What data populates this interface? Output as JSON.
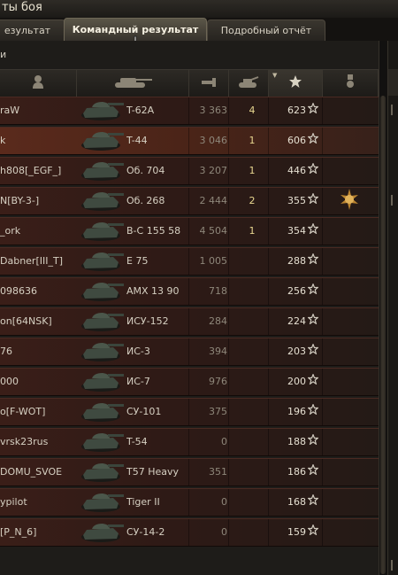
{
  "window": {
    "title": "ты боя"
  },
  "tabs": [
    {
      "label": "езультат",
      "active": false
    },
    {
      "label": "Командный результат",
      "active": true
    },
    {
      "label": "Подробный отчёт",
      "active": false
    }
  ],
  "panel": {
    "corner_label": "и"
  },
  "header": {
    "columns": [
      {
        "name": "player",
        "icon": "person-icon"
      },
      {
        "name": "vehicle",
        "icon": "tank-icon"
      },
      {
        "name": "damage",
        "icon": "shell-damage-icon"
      },
      {
        "name": "kills",
        "icon": "destroyed-tank-icon"
      },
      {
        "name": "experience",
        "icon": "star-icon",
        "sorted": true
      },
      {
        "name": "medals",
        "icon": "medal-icon"
      }
    ]
  },
  "rows": [
    {
      "player": "raW",
      "tank": "T-62A",
      "damage": "3 363",
      "kills": "4",
      "xp": "623",
      "medal": false,
      "highlight": false
    },
    {
      "player": "k",
      "tank": "T-44",
      "damage": "3 046",
      "kills": "1",
      "xp": "606",
      "medal": false,
      "highlight": true
    },
    {
      "player": "h808[_EGF_]",
      "tank": "Об. 704",
      "damage": "3 207",
      "kills": "1",
      "xp": "446",
      "medal": false,
      "highlight": false
    },
    {
      "player": "N[BY-3-]",
      "tank": "Об. 268",
      "damage": "2 444",
      "kills": "2",
      "xp": "355",
      "medal": true,
      "highlight": false
    },
    {
      "player": "_ork",
      "tank": "B-C 155 58",
      "damage": "4 504",
      "kills": "1",
      "xp": "354",
      "medal": false,
      "highlight": false
    },
    {
      "player": "Dabner[III_T]",
      "tank": "E 75",
      "damage": "1 005",
      "kills": "",
      "xp": "288",
      "medal": false,
      "highlight": false
    },
    {
      "player": "098636",
      "tank": "AMX 13 90",
      "damage": "718",
      "kills": "",
      "xp": "256",
      "medal": false,
      "highlight": false
    },
    {
      "player": "on[64NSK]",
      "tank": "ИСУ-152",
      "damage": "284",
      "kills": "",
      "xp": "224",
      "medal": false,
      "highlight": false
    },
    {
      "player": "76",
      "tank": "ИС-3",
      "damage": "394",
      "kills": "",
      "xp": "203",
      "medal": false,
      "highlight": false
    },
    {
      "player": "000",
      "tank": "ИС-7",
      "damage": "976",
      "kills": "",
      "xp": "200",
      "medal": false,
      "highlight": false
    },
    {
      "player": "o[F-WOT]",
      "tank": "СУ-101",
      "damage": "375",
      "kills": "",
      "xp": "196",
      "medal": false,
      "highlight": false
    },
    {
      "player": "vrsk23rus",
      "tank": "T-54",
      "damage": "0",
      "kills": "",
      "xp": "188",
      "medal": false,
      "highlight": false
    },
    {
      "player": "DOMU_SVOE",
      "tank": "T57 Heavy",
      "damage": "351",
      "kills": "",
      "xp": "186",
      "medal": false,
      "highlight": false
    },
    {
      "player": "ypilot",
      "tank": "Tiger II",
      "damage": "0",
      "kills": "",
      "xp": "168",
      "medal": false,
      "highlight": false
    },
    {
      "player": "[P_N_6]",
      "tank": "СУ-14-2",
      "damage": "0",
      "kills": "",
      "xp": "159",
      "medal": false,
      "highlight": false
    }
  ],
  "colors": {
    "accent": "#e8d790",
    "row": "#3a1e18",
    "row_highlight": "#5a2a1c"
  }
}
